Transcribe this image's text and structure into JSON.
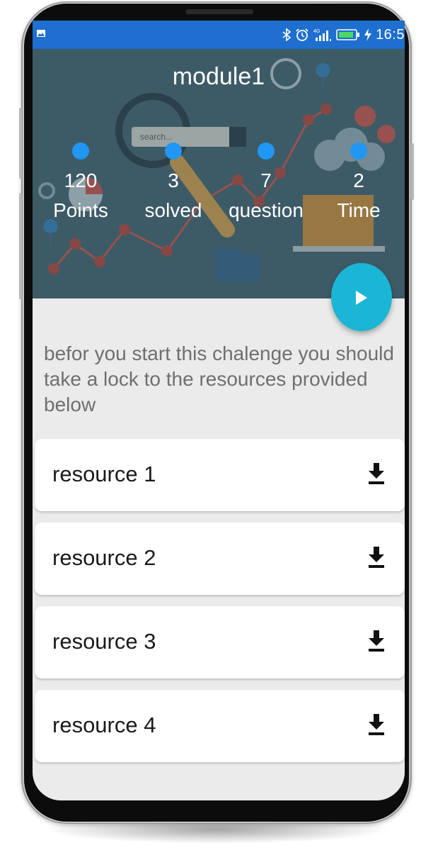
{
  "status_bar": {
    "time": "16:5",
    "icons": [
      "image-icon",
      "bluetooth-icon",
      "alarm-icon",
      "signal-icon",
      "battery-icon",
      "charging-icon"
    ]
  },
  "header": {
    "title": "module1",
    "stats": [
      {
        "value": "120",
        "label": "Points"
      },
      {
        "value": "3",
        "label": "solved"
      },
      {
        "value": "7",
        "label": "question"
      },
      {
        "value": "2",
        "label": "Time"
      }
    ],
    "background_art": {
      "search_text": "search..."
    }
  },
  "play_button": {
    "icon": "play-icon"
  },
  "intro_text": "befor you start this chalenge you should take a lock to the resources provided below",
  "resources": [
    {
      "label": "resource 1",
      "icon": "download-icon"
    },
    {
      "label": "resource 2",
      "icon": "download-icon"
    },
    {
      "label": "resource 3",
      "icon": "download-icon"
    },
    {
      "label": "resource 4",
      "icon": "download-icon"
    }
  ],
  "colors": {
    "status_bar": "#1e6fcf",
    "header_overlay": "#3d5b67",
    "stat_dot": "#2196f3",
    "fab": "#1bb5d6",
    "background": "#ebebeb"
  }
}
